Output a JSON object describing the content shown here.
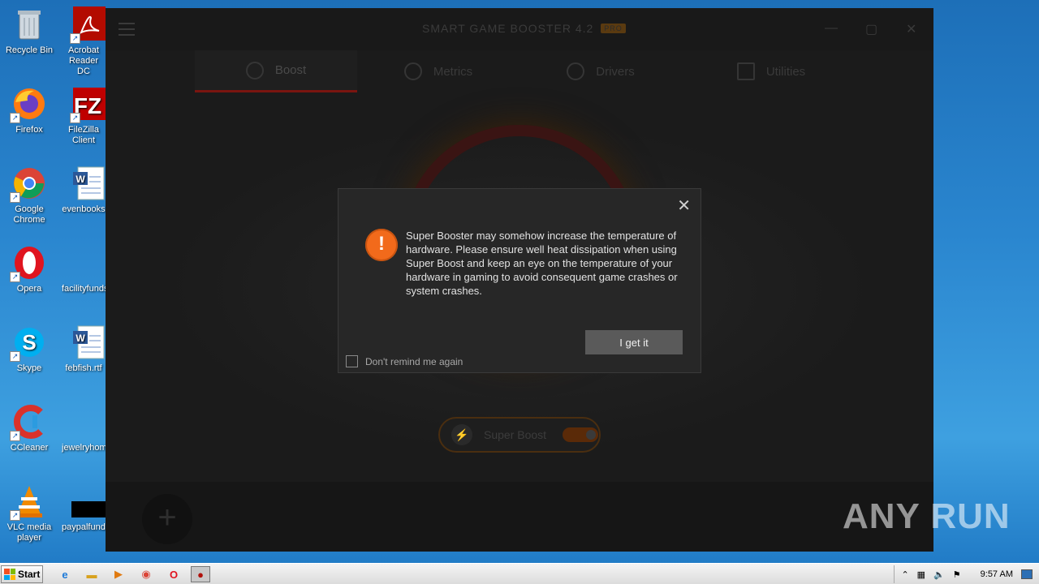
{
  "desktop": {
    "icons_col1": [
      {
        "label": "Recycle Bin",
        "icon": "recycle-bin-icon"
      },
      {
        "label": "Firefox",
        "icon": "firefox-icon"
      },
      {
        "label": "Google Chrome",
        "icon": "chrome-icon"
      },
      {
        "label": "Opera",
        "icon": "opera-icon"
      },
      {
        "label": "Skype",
        "icon": "skype-icon"
      },
      {
        "label": "CCleaner",
        "icon": "ccleaner-icon"
      },
      {
        "label": "VLC media player",
        "icon": "vlc-icon"
      }
    ],
    "icons_col2": [
      {
        "label": "Acrobat Reader DC",
        "icon": "acrobat-icon"
      },
      {
        "label": "FileZilla Client",
        "icon": "filezilla-icon"
      },
      {
        "label": "evenbooks",
        "icon": "word-doc-icon"
      },
      {
        "label": "facilityfunds",
        "icon": "blank-file-icon"
      },
      {
        "label": "febfish.rtf",
        "icon": "word-doc-icon"
      },
      {
        "label": "jewelryhome",
        "icon": "blank-file-icon"
      },
      {
        "label": "paypalfunds",
        "icon": "black-file-icon"
      }
    ]
  },
  "app": {
    "title": "SMART GAME BOOSTER 4.2",
    "pro_badge": "PRO",
    "tabs": [
      {
        "label": "Boost",
        "icon": "rocket-icon"
      },
      {
        "label": "Metrics",
        "icon": "gauge-icon"
      },
      {
        "label": "Drivers",
        "icon": "gear-icon"
      },
      {
        "label": "Utilities",
        "icon": "grid-icon"
      }
    ],
    "super_boost_label": "Super Boost"
  },
  "modal": {
    "message": "Super Booster may somehow increase the temperature of hardware. Please ensure well heat dissipation when using Super Boost and keep an eye on the temperature of your hardware in gaming to avoid consequent game crashes or system crashes.",
    "ok_button": "I get it",
    "remind_label": "Don't remind me again",
    "close_glyph": "✕",
    "warn_glyph": "!",
    "accent_color": "#f26a1b"
  },
  "watermark": "ANY RUN",
  "taskbar": {
    "start_label": "Start",
    "clock": "9:57 AM"
  }
}
